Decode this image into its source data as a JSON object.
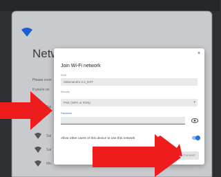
{
  "background": {
    "title": "Netw",
    "lines": [
      "Please conn",
      "If you're on"
    ],
    "networks": [
      "Sal",
      "Sal",
      "Sal",
      "Mic"
    ]
  },
  "dialog": {
    "title": "Join Wi-Fi network",
    "close_glyph": "×",
    "ssid": {
      "label": "SSID",
      "value": "Salamandra 2.4_EXT"
    },
    "security": {
      "label": "Security",
      "value": "PSK (WPA or RSN)"
    },
    "password": {
      "label": "Password",
      "value": ""
    },
    "allow_text": "Allow other users of this device to use this network",
    "allow_enabled": true,
    "connect_label": "Connect"
  },
  "colors": {
    "accent": "#1a73e8",
    "arrow": "#ee1c1c"
  },
  "icons": [
    "wifi-logo-icon",
    "wifi-icon",
    "close-icon",
    "eye-icon",
    "chevron-down-icon",
    "arrow-icon"
  ]
}
